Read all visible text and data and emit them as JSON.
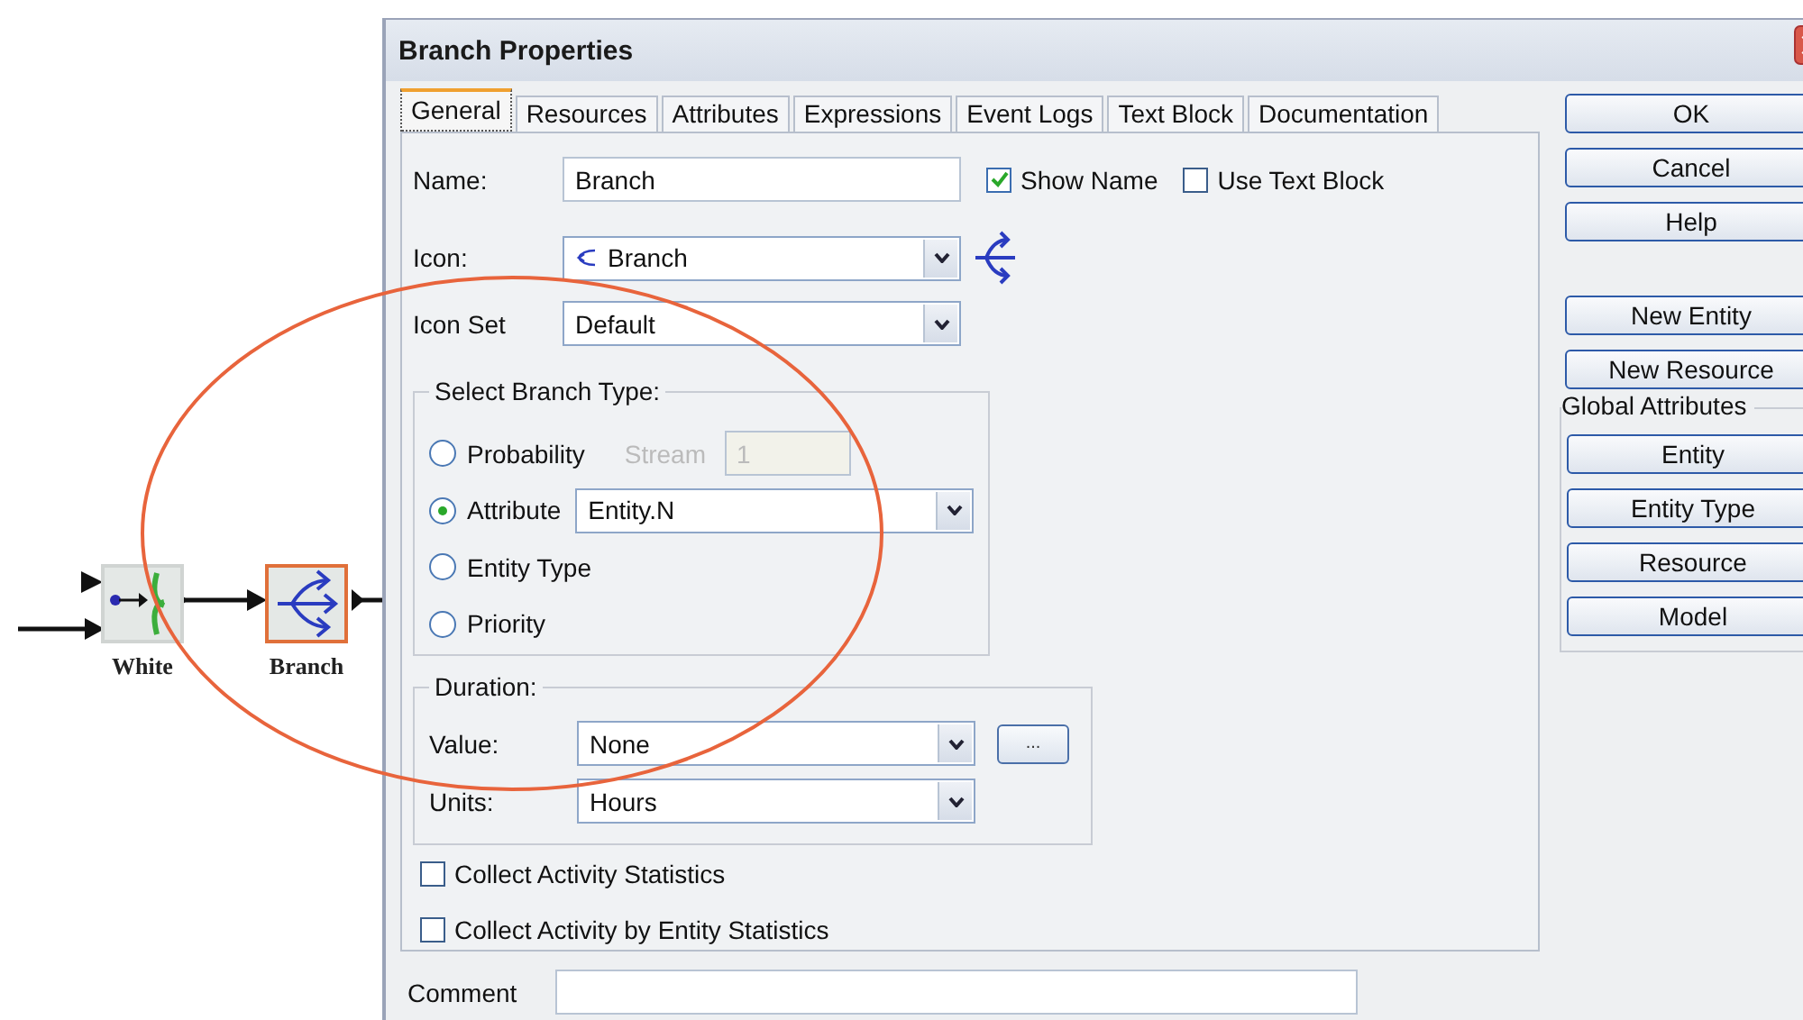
{
  "canvas": {
    "nodes": [
      {
        "label": "White",
        "kind": "join",
        "selected": false
      },
      {
        "label": "Branch",
        "kind": "branch",
        "selected": true
      }
    ]
  },
  "window": {
    "title": "Branch Properties"
  },
  "tabs": [
    {
      "label": "General",
      "selected": true
    },
    {
      "label": "Resources",
      "selected": false
    },
    {
      "label": "Attributes",
      "selected": false
    },
    {
      "label": "Expressions",
      "selected": false
    },
    {
      "label": "Event Logs",
      "selected": false
    },
    {
      "label": "Text Block",
      "selected": false
    },
    {
      "label": "Documentation",
      "selected": false
    }
  ],
  "general": {
    "name_label": "Name:",
    "name_value": "Branch",
    "show_name": {
      "label": "Show Name",
      "checked": true
    },
    "use_text_block": {
      "label": "Use Text Block",
      "checked": false
    },
    "icon_label": "Icon:",
    "icon_value": "Branch",
    "icon_set_label": "Icon Set",
    "icon_set_value": "Default",
    "branch_type": {
      "legend": "Select Branch Type:",
      "options": [
        {
          "label": "Probability",
          "selected": false,
          "kind": "stream"
        },
        {
          "label": "Attribute",
          "selected": true,
          "kind": "dropdown"
        },
        {
          "label": "Entity Type",
          "selected": false,
          "kind": "plain"
        },
        {
          "label": "Priority",
          "selected": false,
          "kind": "plain"
        }
      ],
      "stream_label": "Stream",
      "stream_value": "1",
      "stream_disabled": true,
      "attribute_value": "Entity.N"
    },
    "duration": {
      "legend": "Duration:",
      "value_label": "Value:",
      "value": "None",
      "browse_button": "...",
      "units_label": "Units:",
      "units": "Hours"
    },
    "checkboxes": [
      {
        "label": "Collect Activity Statistics",
        "checked": false
      },
      {
        "label": "Collect Activity by Entity Statistics",
        "checked": false
      }
    ]
  },
  "comment": {
    "label": "Comment"
  },
  "buttons": [
    "OK",
    "Cancel",
    "Help"
  ],
  "entity_buttons": [
    "New Entity",
    "New Resource"
  ],
  "global_attributes": {
    "title": "Global Attributes",
    "buttons": [
      "Entity",
      "Entity Type",
      "Resource",
      "Model"
    ]
  }
}
